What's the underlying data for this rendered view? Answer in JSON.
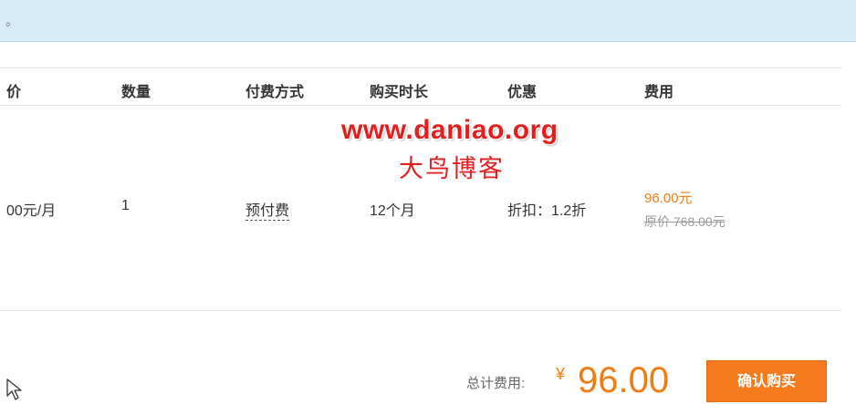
{
  "notice": {
    "text": "。"
  },
  "table": {
    "headers": [
      "价",
      "数量",
      "付费方式",
      "购买时长",
      "优惠",
      "费用"
    ],
    "row": {
      "unit_price": "00元/月",
      "quantity": "1",
      "payment_method": "预付费",
      "duration": "12个月",
      "discount": "折扣：1.2折",
      "price_now": "96.00元",
      "price_original": "原价 768.00元"
    }
  },
  "watermark": {
    "site": "www.daniao.org",
    "name_cn": "大鸟博客"
  },
  "footer": {
    "total_label": "总计费用:",
    "currency": "¥",
    "total_value": "96.00",
    "confirm_label": "确认购买"
  },
  "colors": {
    "accent": "#f07c14",
    "button": "#f47a1c",
    "notice_bg": "#d9ecfa",
    "watermark": "#e21f1f"
  },
  "icons": {
    "cursor": "mouse-pointer-icon"
  }
}
